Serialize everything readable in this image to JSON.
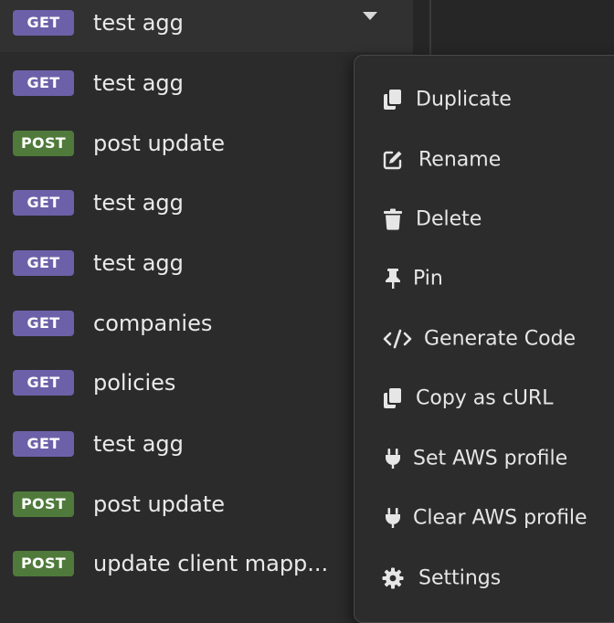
{
  "requests": [
    {
      "method": "GET",
      "name": "test agg"
    },
    {
      "method": "GET",
      "name": "test agg"
    },
    {
      "method": "POST",
      "name": "post update"
    },
    {
      "method": "GET",
      "name": "test agg"
    },
    {
      "method": "GET",
      "name": "test agg"
    },
    {
      "method": "GET",
      "name": "companies"
    },
    {
      "method": "GET",
      "name": "policies"
    },
    {
      "method": "GET",
      "name": "test agg"
    },
    {
      "method": "POST",
      "name": "post update"
    },
    {
      "method": "POST",
      "name": "update client mapp..."
    }
  ],
  "context_menu": {
    "items": [
      {
        "label": "Duplicate",
        "icon": "duplicate-icon"
      },
      {
        "label": "Rename",
        "icon": "edit-icon"
      },
      {
        "label": "Delete",
        "icon": "trash-icon"
      },
      {
        "label": "Pin",
        "icon": "pin-icon"
      },
      {
        "label": "Generate Code",
        "icon": "code-icon"
      },
      {
        "label": "Copy as cURL",
        "icon": "copy-icon"
      },
      {
        "label": "Set AWS profile",
        "icon": "plug-icon"
      },
      {
        "label": "Clear AWS profile",
        "icon": "plug-icon"
      },
      {
        "label": "Settings",
        "icon": "gear-icon"
      }
    ]
  },
  "colors": {
    "get_badge": "#6c61a8",
    "post_badge": "#4f7a3b",
    "background": "#2b2b2b",
    "menu_background": "#2c2c2c"
  }
}
